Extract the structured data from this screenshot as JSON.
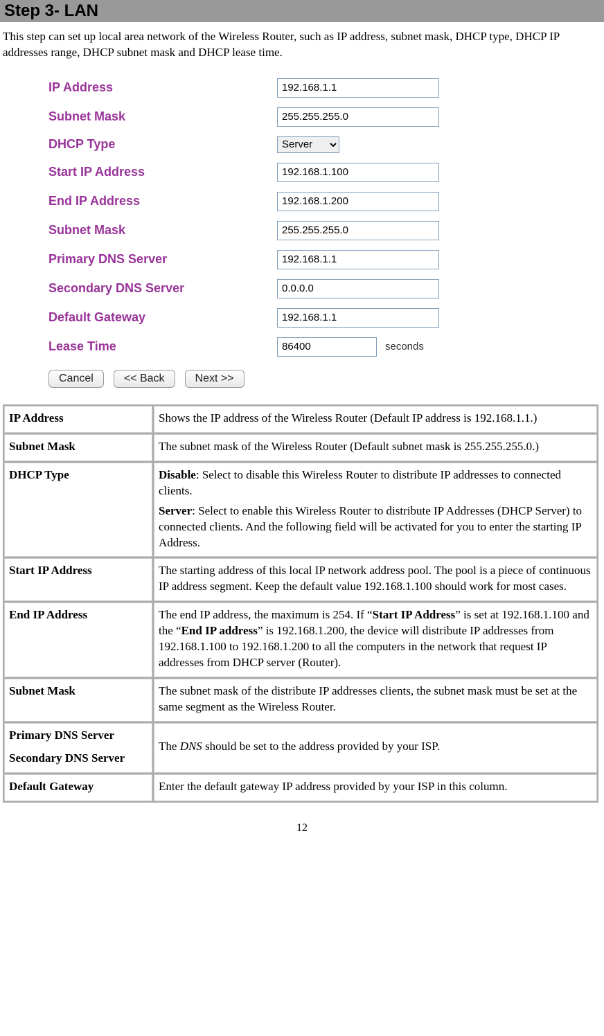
{
  "title": "Step 3- LAN",
  "intro": "This step can set up local area network of the Wireless  Router, such as IP address, subnet mask, DHCP type, DHCP IP addresses range, DHCP subnet mask and DHCP lease time.",
  "form": {
    "ip_address": {
      "label": "IP Address",
      "value": "192.168.1.1"
    },
    "subnet_mask": {
      "label": "Subnet Mask",
      "value": "255.255.255.0"
    },
    "dhcp_type": {
      "label": "DHCP Type",
      "value": "Server"
    },
    "start_ip": {
      "label": "Start IP Address",
      "value": "192.168.1.100"
    },
    "end_ip": {
      "label": "End IP Address",
      "value": "192.168.1.200"
    },
    "subnet_mask2": {
      "label": "Subnet Mask",
      "value": "255.255.255.0"
    },
    "primary_dns": {
      "label": "Primary DNS Server",
      "value": "192.168.1.1"
    },
    "secondary_dns": {
      "label": "Secondary DNS Server",
      "value": "0.0.0.0"
    },
    "default_gateway": {
      "label": "Default Gateway",
      "value": "192.168.1.1"
    },
    "lease_time": {
      "label": "Lease Time",
      "value": "86400",
      "suffix": "seconds"
    }
  },
  "buttons": {
    "cancel": "Cancel",
    "back": "<<  Back",
    "next": "Next >>"
  },
  "table": {
    "rows": [
      {
        "label": "IP Address",
        "desc_plain": "Shows the IP address of the Wireless  Router (Default IP address is 192.168.1.1.)"
      },
      {
        "label": "Subnet Mask",
        "desc_plain": "The subnet mask of the Wireless  Router (Default subnet mask is 255.255.255.0.)"
      },
      {
        "label": "DHCP Type",
        "desc_dhcp": {
          "disable_label": "Disable",
          "disable_text": ": Select to disable this Wireless  Router to distribute IP addresses to connected clients.",
          "server_label": "Server",
          "server_text": ": Select to enable this Wireless  Router to distribute IP Addresses (DHCP Server) to connected clients. And the following field will be activated for you to enter the starting IP Address."
        }
      },
      {
        "label": "Start IP Address",
        "desc_plain": "The starting address of this local IP network address pool. The pool is a piece of continuous IP address segment. Keep the default value 192.168.1.100 should work for most cases."
      },
      {
        "label": "End IP Address",
        "desc_endip": {
          "p1": "The end IP address, the maximum is 254. If “",
          "b1": "Start IP Address",
          "p2": "” is set at 192.168.1.100 and the “",
          "b2": "End IP address",
          "p3": "” is 192.168.1.200, the device will distribute IP addresses from 192.168.1.100 to 192.168.1.200 to all the computers in the network that request IP addresses from DHCP server (Router)."
        }
      },
      {
        "label": "Subnet Mask",
        "desc_plain": "The subnet mask of the distribute IP addresses clients, the subnet mask must be set at the same segment as the Wireless  Router."
      },
      {
        "label_dns1": "Primary DNS Server",
        "label_dns2": "Secondary DNS Server",
        "desc_dns": {
          "p1": "The ",
          "i1": "DNS",
          "p2": " should be set to the address provided by your ISP."
        }
      },
      {
        "label": "Default Gateway",
        "desc_plain": "Enter the default gateway IP address provided by your ISP in this column."
      }
    ]
  },
  "page_number": "12"
}
